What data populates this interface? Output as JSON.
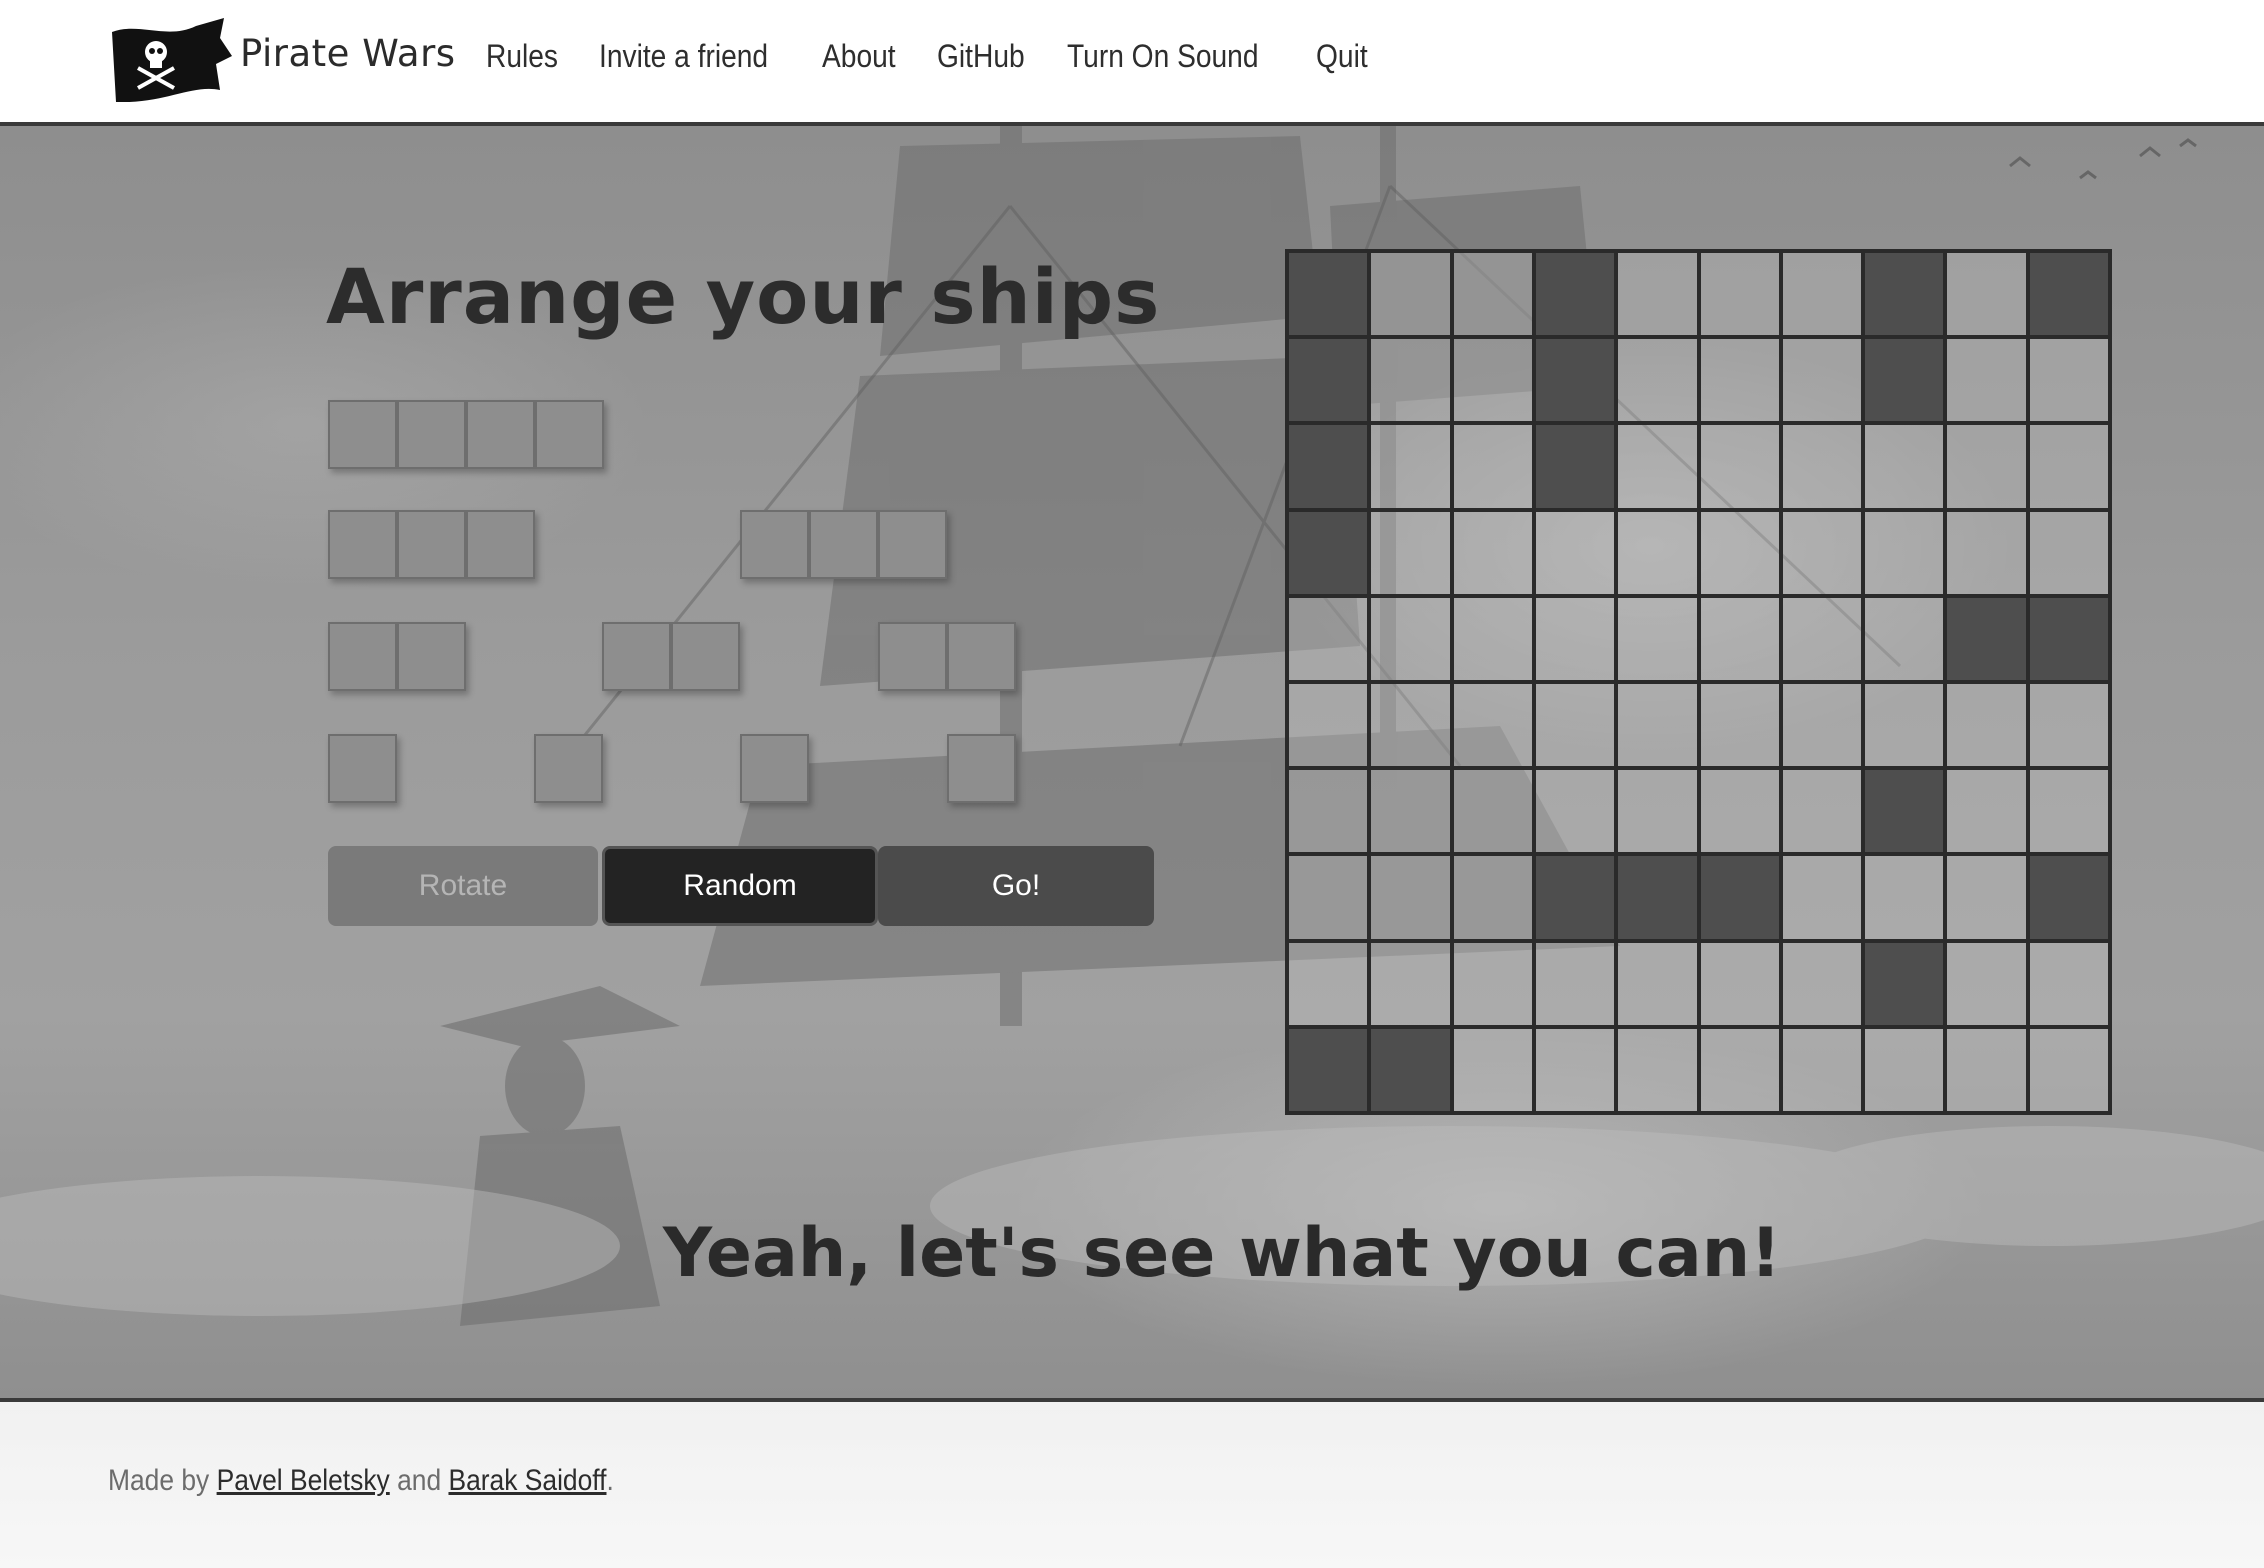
{
  "nav": {
    "brand": "Pirate Wars",
    "links": [
      "Rules",
      "Invite a friend",
      "About",
      "GitHub",
      "Turn On Sound",
      "Quit"
    ]
  },
  "main": {
    "title": "Arrange your ships",
    "buttons": {
      "rotate": "Rotate",
      "random": "Random",
      "go": "Go!"
    },
    "slogan": "Yeah, let's see what you can!"
  },
  "ships": {
    "sizes": [
      4,
      3,
      3,
      2,
      2,
      2,
      1,
      1,
      1,
      1
    ]
  },
  "board": {
    "rows": 10,
    "cols": 10,
    "filled": [
      [
        0,
        0
      ],
      [
        0,
        3
      ],
      [
        0,
        7
      ],
      [
        0,
        9
      ],
      [
        1,
        0
      ],
      [
        1,
        3
      ],
      [
        1,
        7
      ],
      [
        2,
        0
      ],
      [
        2,
        3
      ],
      [
        3,
        0
      ],
      [
        4,
        8
      ],
      [
        4,
        9
      ],
      [
        6,
        7
      ],
      [
        7,
        3
      ],
      [
        7,
        4
      ],
      [
        7,
        5
      ],
      [
        7,
        9
      ],
      [
        8,
        7
      ],
      [
        9,
        0
      ],
      [
        9,
        1
      ]
    ]
  },
  "footer": {
    "made_by": "Made by ",
    "author1": "Pavel Beletsky",
    "and": " and ",
    "author2": "Barak Saidoff",
    "period": "."
  },
  "colors": {
    "ship_cell": "#8e8e8e",
    "board_filled": "#4e4e4e",
    "random_button": "#232323",
    "go_button": "#4b4b4b",
    "rotate_button": "#7a7a7a"
  }
}
